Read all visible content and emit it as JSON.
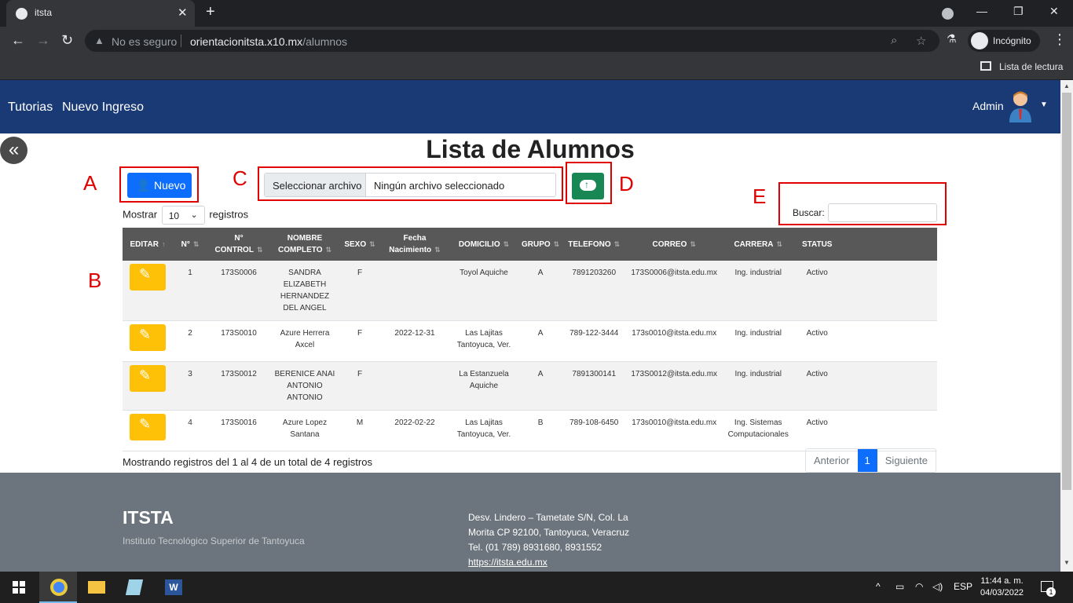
{
  "browser": {
    "tab_title": "itsta",
    "insecure_label": "No es seguro",
    "url_host": "orientacionitsta.x10.mx",
    "url_path": "/alumnos",
    "incognito_label": "Incógnito",
    "reading_list": "Lista de lectura"
  },
  "nav": {
    "links": [
      "Tutorias",
      "Nuevo Ingreso"
    ],
    "user": "Admin"
  },
  "page": {
    "title": "Lista de Alumnos",
    "nuevo_button": "Nuevo",
    "file_button": "Seleccionar archivo",
    "file_status": "Ningún archivo seleccionado",
    "annotations": [
      "A",
      "B",
      "C",
      "D",
      "E"
    ],
    "show_prefix": "Mostrar",
    "show_value": "10",
    "show_suffix": "registros",
    "search_label": "Buscar:",
    "info": "Mostrando registros del 1 al 4 de un total de 4 registros",
    "pager": {
      "prev": "Anterior",
      "current": "1",
      "next": "Siguiente"
    }
  },
  "table": {
    "headers": [
      "EDITAR",
      "N°",
      "N° CONTROL",
      "NOMBRE COMPLETO",
      "SEXO",
      "Fecha Nacimiento",
      "DOMICILIO",
      "GRUPO",
      "TELEFONO",
      "CORREO",
      "CARRERA",
      "STATUS"
    ],
    "rows": [
      {
        "n": "1",
        "control": "173S0006",
        "nombre": "SANDRA ELIZABETH HERNANDEZ DEL ANGEL",
        "sexo": "F",
        "fecha": "",
        "domicilio": "Toyol Aquiche",
        "grupo": "A",
        "telefono": "7891203260",
        "correo": "173S0006@itsta.edu.mx",
        "carrera": "Ing. industrial",
        "status": "Activo"
      },
      {
        "n": "2",
        "control": "173S0010",
        "nombre": "Azure Herrera Axcel",
        "sexo": "F",
        "fecha": "2022-12-31",
        "domicilio": "Las Lajitas Tantoyuca, Ver.",
        "grupo": "A",
        "telefono": "789-122-3444",
        "correo": "173s0010@itsta.edu.mx",
        "carrera": "Ing. industrial",
        "status": "Activo"
      },
      {
        "n": "3",
        "control": "173S0012",
        "nombre": "BERENICE ANAI ANTONIO ANTONIO",
        "sexo": "F",
        "fecha": "",
        "domicilio": "La Estanzuela Aquiche",
        "grupo": "A",
        "telefono": "7891300141",
        "correo": "173S0012@itsta.edu.mx",
        "carrera": "Ing. industrial",
        "status": "Activo"
      },
      {
        "n": "4",
        "control": "173S0016",
        "nombre": "Azure Lopez Santana",
        "sexo": "M",
        "fecha": "2022-02-22",
        "domicilio": "Las Lajitas Tantoyuca, Ver.",
        "grupo": "B",
        "telefono": "789-108-6450",
        "correo": "173s0010@itsta.edu.mx",
        "carrera": "Ing. Sistemas Computacionales",
        "status": "Activo"
      }
    ]
  },
  "footer": {
    "title": "ITSTA",
    "subtitle": "Instituto Tecnológico Superior de Tantoyuca",
    "address_1": "Desv. Lindero – Tametate S/N, Col. La Morita CP 92100, Tantoyuca, Veracruz",
    "phone": "Tel. (01 789) 8931680, 8931552",
    "link": "https://itsta.edu.mx"
  },
  "taskbar": {
    "lang": "ESP",
    "time": "11:44 a. m.",
    "date": "04/03/2022",
    "notifications": "1"
  },
  "colors": {
    "navbar": "#1a3a75",
    "primary": "#0d6efd",
    "success": "#198754",
    "warning": "#ffc107",
    "annotation": "#e00000"
  }
}
